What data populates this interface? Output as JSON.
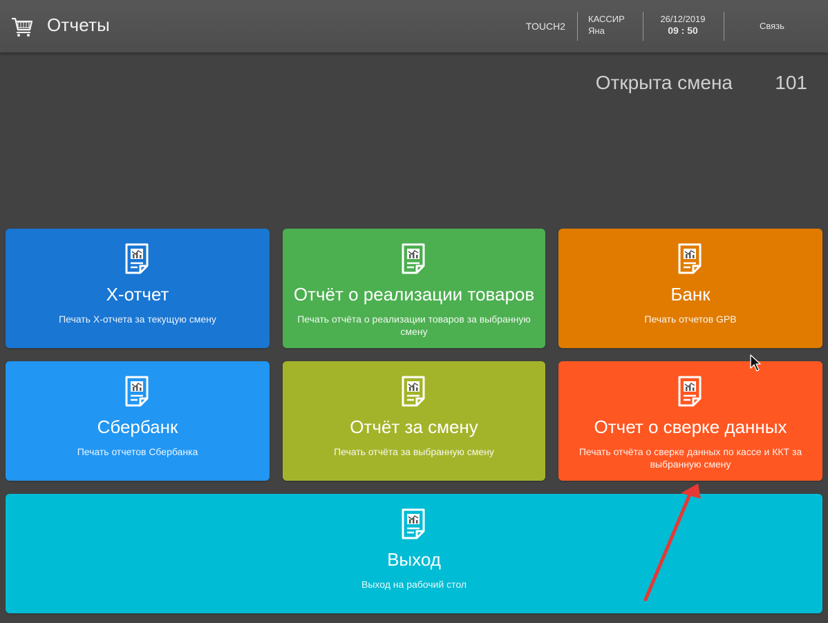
{
  "header": {
    "icon": "cart-icon",
    "title": "Отчеты",
    "terminal": "TOUCH2",
    "cashier_role": "КАССИР",
    "cashier_name": "Яна",
    "date": "26/12/2019",
    "time": "09 : 50",
    "link_label": "Связь"
  },
  "shift": {
    "label": "Открыта смена",
    "number": "101"
  },
  "tiles": [
    {
      "icon": "report-icon",
      "title": "X-отчет",
      "subtitle": "Печать X-отчета за текущую смену",
      "color": "#1976D2"
    },
    {
      "icon": "report-icon",
      "title": "Отчёт о реализации товаров",
      "subtitle": "Печать отчёта о реализации товаров за выбранную смену",
      "color": "#4CAF50"
    },
    {
      "icon": "report-icon",
      "title": "Банк",
      "subtitle": "Печать отчетов GPB",
      "color": "#E07B00"
    },
    {
      "icon": "report-icon",
      "title": "Сбербанк",
      "subtitle": "Печать отчетов Сбербанка",
      "color": "#2196F3"
    },
    {
      "icon": "report-icon",
      "title": "Отчёт за смену",
      "subtitle": "Печать отчёта за выбранную смену",
      "color": "#A4B42A"
    },
    {
      "icon": "report-icon",
      "title": "Отчет о сверке данных",
      "subtitle": "Печать отчёта о сверке данных по кассе и ККТ за выбранную смену",
      "color": "#FF5722"
    },
    {
      "icon": "report-icon",
      "title": "Выход",
      "subtitle": "Выход на рабочий стол",
      "color": "#00BCD4"
    }
  ],
  "annotation": {
    "arrow_color": "#E53935"
  }
}
